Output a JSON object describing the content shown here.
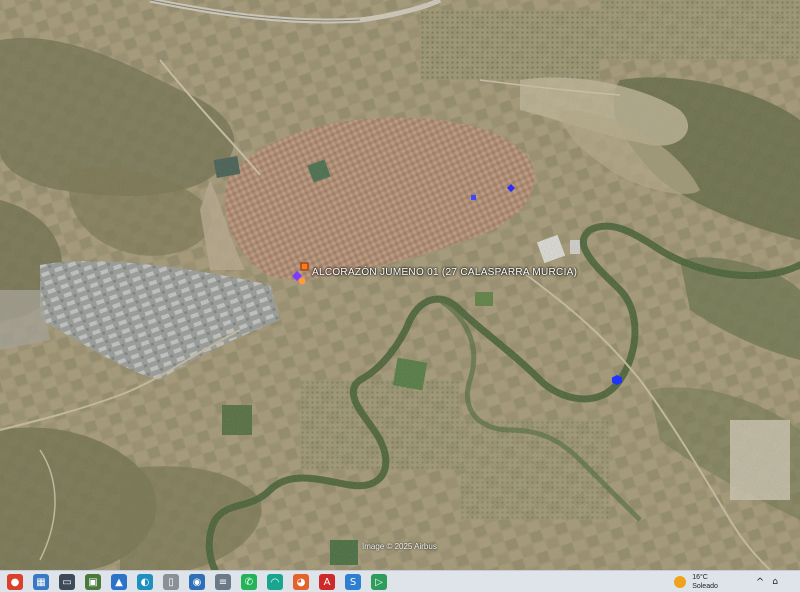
{
  "map": {
    "place_label": "ALCORAZÓN JUMENO 01 (27 CALASPARRA MURCIA)",
    "credit": "Image © 2025 Airbus",
    "accent": {
      "orange": "#ff7a1a",
      "blue": "#2a2cff",
      "purple": "#7b3cff"
    }
  },
  "taskbar": {
    "icons": [
      {
        "name": "chrome-icon",
        "glyph": "●",
        "color": "#d9412b"
      },
      {
        "name": "recycle-bin-icon",
        "glyph": "▦",
        "color": "#3a78c3"
      },
      {
        "name": "explorer-icon",
        "glyph": "▭",
        "color": "#3e4a58"
      },
      {
        "name": "control-panel-icon",
        "glyph": "▣",
        "color": "#4a7a3b"
      },
      {
        "name": "photos-icon",
        "glyph": "▲",
        "color": "#2d73c8"
      },
      {
        "name": "edge-icon",
        "glyph": "◐",
        "color": "#1f8fbf"
      },
      {
        "name": "document-icon",
        "glyph": "▯",
        "color": "#8a8f98"
      },
      {
        "name": "file-manager-icon",
        "glyph": "◉",
        "color": "#2f6fb5"
      },
      {
        "name": "notepad-icon",
        "glyph": "≡",
        "color": "#6b7a89"
      },
      {
        "name": "whatsapp-icon",
        "glyph": "✆",
        "color": "#25b35a"
      },
      {
        "name": "copilot-icon",
        "glyph": "◠",
        "color": "#19a58f"
      },
      {
        "name": "firefox-icon",
        "glyph": "◕",
        "color": "#e4622b"
      },
      {
        "name": "acrobat-icon",
        "glyph": "A",
        "color": "#cf2a2a"
      },
      {
        "name": "s-app-icon",
        "glyph": "S",
        "color": "#2e7fcf"
      },
      {
        "name": "green-app-icon",
        "glyph": "▷",
        "color": "#2e9c5a"
      }
    ],
    "weather": {
      "temp": "16°C",
      "condition": "Soleado"
    },
    "tray_chevron": "^",
    "network_glyph": "⌂"
  }
}
